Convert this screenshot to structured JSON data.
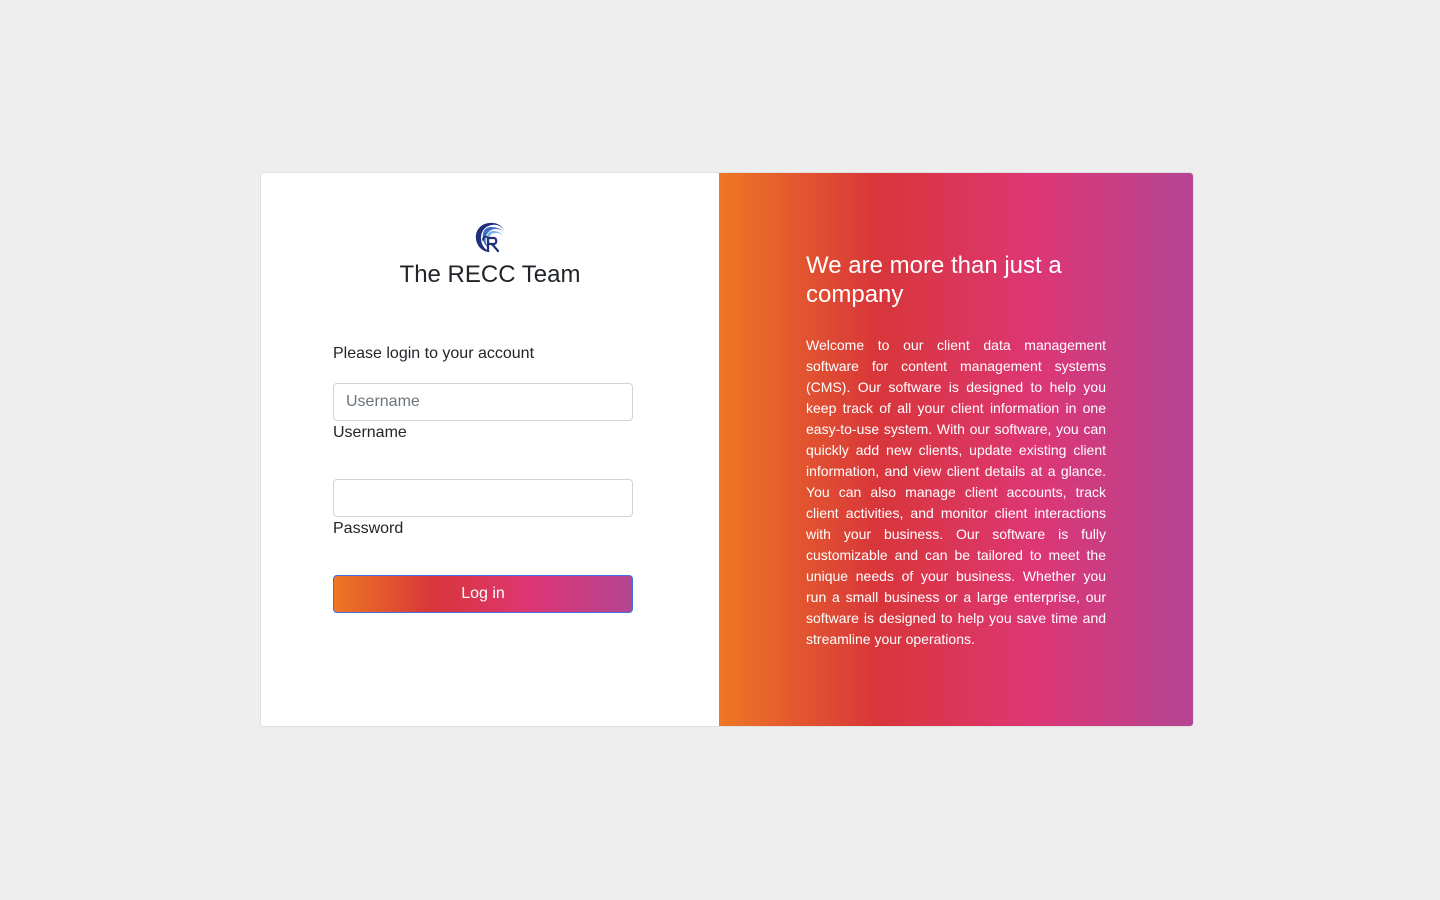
{
  "brand": {
    "title": "The RECC Team",
    "logo_icon": "recc-logo-icon"
  },
  "login_form": {
    "intro": "Please login to your account",
    "username": {
      "placeholder": "Username",
      "value": "",
      "label": "Username"
    },
    "password": {
      "placeholder": "",
      "value": "",
      "label": "Password"
    },
    "submit_label": "Log in"
  },
  "info": {
    "title": "We are more than just a company",
    "body": "Welcome to our client data management software for content management systems (CMS). Our software is designed to help you keep track of all your client information in one easy-to-use system. With our software, you can quickly add new clients, update existing client information, and view client details at a glance. You can also manage client accounts, track client activities, and monitor client interactions with your business. Our software is fully customizable and can be tailored to meet the unique needs of your business. Whether you run a small business or a large enterprise, our software is designed to help you save time and streamline your operations."
  },
  "colors": {
    "page_background": "#eeeeee",
    "gradient": [
      "#ee7724",
      "#d8363a",
      "#dd3675",
      "#b44593"
    ],
    "logo_blue": "#1f2f7a"
  }
}
